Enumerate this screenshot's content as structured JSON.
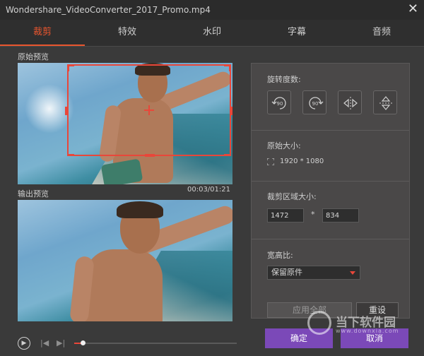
{
  "window": {
    "title": "Wondershare_VideoConverter_2017_Promo.mp4",
    "close_glyph": "✕"
  },
  "tabs": [
    {
      "label": "裁剪",
      "active": true
    },
    {
      "label": "特效",
      "active": false
    },
    {
      "label": "水印",
      "active": false
    },
    {
      "label": "字幕",
      "active": false
    },
    {
      "label": "音频",
      "active": false
    }
  ],
  "preview": {
    "original_label": "原始预览",
    "output_label": "输出预览",
    "timestamp": "00:03/01:21"
  },
  "player": {
    "play_glyph": "▶",
    "prev_glyph": "|◀",
    "next_glyph": "▶|",
    "progress_fraction": 0.05
  },
  "panel": {
    "rotation_label": "旋转度数:",
    "rotation_buttons": [
      {
        "icon": "rotate-left-90-icon",
        "text": "90"
      },
      {
        "icon": "rotate-right-90-icon",
        "text": "90"
      },
      {
        "icon": "flip-horizontal-icon",
        "text": ""
      },
      {
        "icon": "flip-vertical-icon",
        "text": ""
      }
    ],
    "original_size_label": "原始大小:",
    "original_size_value": "1920 * 1080",
    "crop_area_label": "裁剪区域大小:",
    "crop_width": "1472",
    "crop_height": "834",
    "times_sign": "*",
    "aspect_label": "宽高比:",
    "aspect_value": "保留原件",
    "apply_all_label": "应用全部",
    "reset_label": "重设"
  },
  "footer": {
    "ok_label": "确定",
    "cancel_label": "取消"
  },
  "watermark": {
    "text": "当下软件园",
    "url": "www.downxia.com"
  },
  "colors": {
    "accent": "#e8552e",
    "crop_red": "#e8473a",
    "button_purple": "#7b49b8"
  }
}
